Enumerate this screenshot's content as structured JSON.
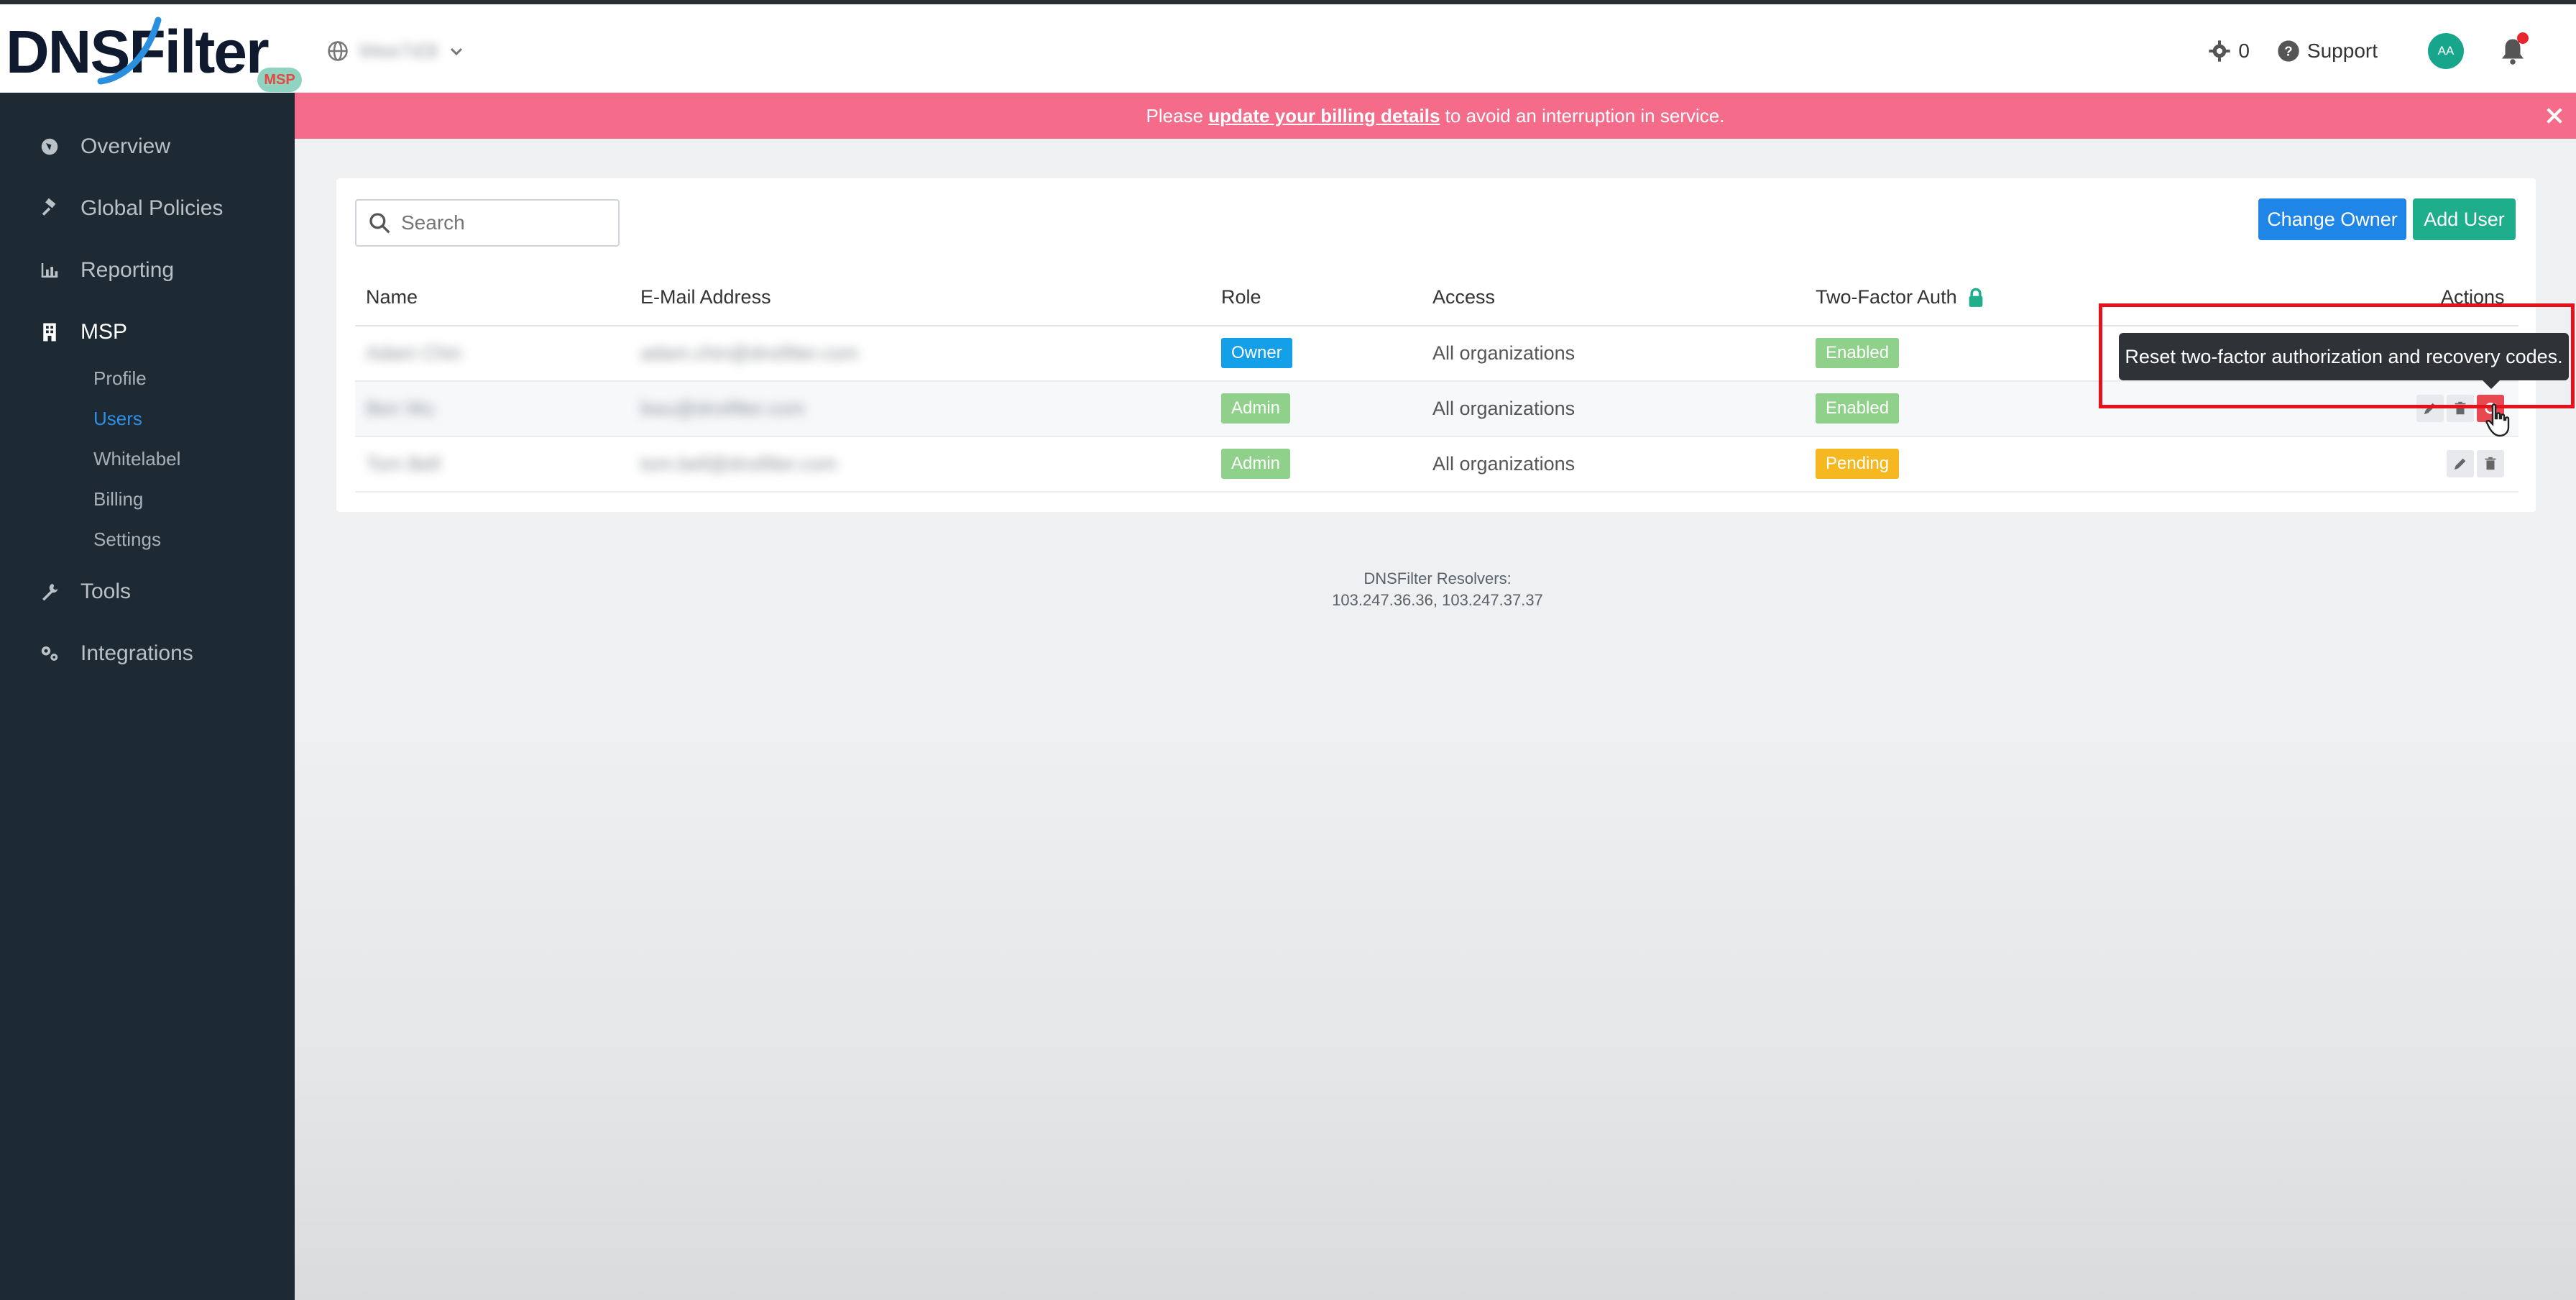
{
  "header": {
    "logo_text": "DNSFilter",
    "logo_badge": "MSP",
    "org_name": "Wee7d3l",
    "settings_count": "0",
    "support_label": "Support",
    "avatar_initials": "AA"
  },
  "sidebar": {
    "items": [
      {
        "label": "Overview",
        "icon": "globe-icon"
      },
      {
        "label": "Global Policies",
        "icon": "gavel-icon"
      },
      {
        "label": "Reporting",
        "icon": "bar-chart-icon"
      },
      {
        "label": "MSP",
        "icon": "building-icon"
      },
      {
        "label": "Tools",
        "icon": "wrench-icon"
      },
      {
        "label": "Integrations",
        "icon": "gears-icon"
      }
    ],
    "msp_subitems": [
      "Profile",
      "Users",
      "Whitelabel",
      "Billing",
      "Settings"
    ],
    "active_subitem": "Users"
  },
  "banner": {
    "prefix": "Please ",
    "link": "update your billing details",
    "suffix": " to avoid an interruption in service."
  },
  "toolbar": {
    "search_placeholder": "Search",
    "change_owner_label": "Change Owner",
    "add_user_label": "Add User"
  },
  "table": {
    "columns": [
      "Name",
      "E-Mail Address",
      "Role",
      "Access",
      "Two-Factor Auth",
      "Actions"
    ],
    "rows": [
      {
        "name": "Adam Chin",
        "email": "adam.chin@dnsfilter.com",
        "role": "Owner",
        "access": "All organizations",
        "twofa": "Enabled"
      },
      {
        "name": "Ben Wu",
        "email": "bwu@dnsfilter.com",
        "role": "Admin",
        "access": "All organizations",
        "twofa": "Enabled"
      },
      {
        "name": "Tom Bell",
        "email": "tom.bell@dnsfilter.com",
        "role": "Admin",
        "access": "All organizations",
        "twofa": "Pending"
      }
    ]
  },
  "tooltip": {
    "text": "Reset two-factor authorization and recovery codes."
  },
  "footer": {
    "label": "DNSFilter Resolvers:",
    "resolvers": "103.247.36.36, 103.247.37.37"
  },
  "colors": {
    "sidebar_bg": "#1e2a33",
    "banner_bg": "#f56c8b",
    "primary": "#1f86e8",
    "success": "#1fae8c",
    "owner_badge": "#13a0e8",
    "enabled_badge": "#8fd08a",
    "pending_badge": "#f6b820",
    "danger": "#e8484f"
  }
}
